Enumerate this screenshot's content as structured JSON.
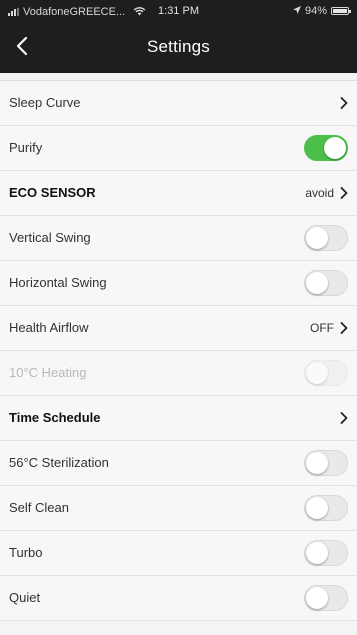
{
  "status_bar": {
    "carrier": "VodafoneGREECE...",
    "time": "1:31 PM",
    "battery": "94%"
  },
  "nav": {
    "title": "Settings",
    "back_icon": "chevron-left-icon"
  },
  "rows": [
    {
      "label": "Sleep Curve",
      "control": "chevron"
    },
    {
      "label": "Purify",
      "control": "toggle",
      "on": true
    },
    {
      "label": "ECO SENSOR",
      "control": "value-chevron",
      "value": "avoid"
    },
    {
      "label": "Vertical Swing",
      "control": "toggle",
      "on": false
    },
    {
      "label": "Horizontal Swing",
      "control": "toggle",
      "on": false
    },
    {
      "label": "Health Airflow",
      "control": "value-chevron",
      "value": "OFF"
    },
    {
      "label": "10°C Heating",
      "control": "toggle",
      "on": false,
      "disabled": true
    },
    {
      "label": "Time Schedule",
      "control": "chevron"
    },
    {
      "label": "56°C Sterilization",
      "control": "toggle",
      "on": false
    },
    {
      "label": "Self Clean",
      "control": "toggle",
      "on": false
    },
    {
      "label": "Turbo",
      "control": "toggle",
      "on": false
    },
    {
      "label": "Quiet",
      "control": "toggle",
      "on": false
    }
  ],
  "colors": {
    "header_bg": "#1e1e1e",
    "toggle_on": "#4cbf4a",
    "toggle_off": "#e9e9e9"
  }
}
